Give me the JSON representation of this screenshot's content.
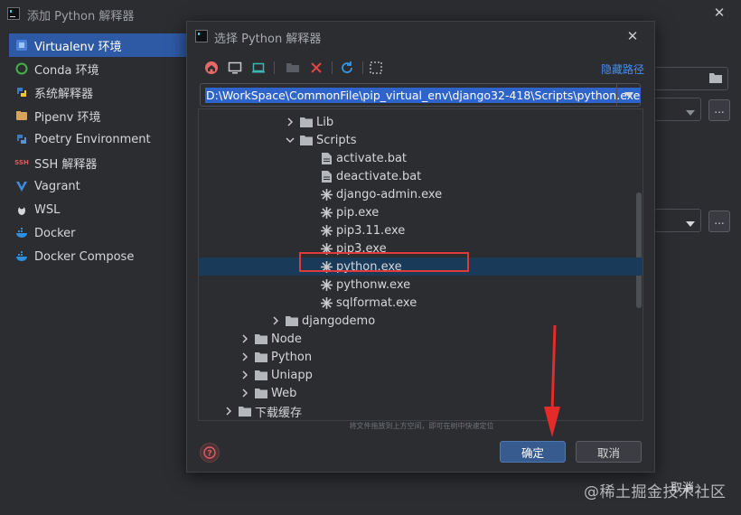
{
  "window": {
    "title": "添加 Python 解释器",
    "close": "✕"
  },
  "sidebar": {
    "items": [
      {
        "label": "Virtualenv 环境",
        "icon": "virtualenv-icon"
      },
      {
        "label": "Conda 环境",
        "icon": "conda-icon"
      },
      {
        "label": "系统解释器",
        "icon": "python-icon"
      },
      {
        "label": "Pipenv 环境",
        "icon": "pipenv-icon"
      },
      {
        "label": "Poetry Environment",
        "icon": "poetry-icon"
      },
      {
        "label": "SSH 解释器",
        "icon": "ssh-icon"
      },
      {
        "label": "Vagrant",
        "icon": "vagrant-icon"
      },
      {
        "label": "WSL",
        "icon": "linux-icon"
      },
      {
        "label": "Docker",
        "icon": "docker-icon"
      },
      {
        "label": "Docker Compose",
        "icon": "docker-compose-icon"
      }
    ]
  },
  "background": {
    "browse_btn": "...",
    "cancel_label": "取消"
  },
  "dialog": {
    "title": "选择 Python 解释器",
    "close": "✕",
    "hide_path": "隐藏路径",
    "path": "D:\\WorkSpace\\CommonFile\\pip_virtual_env\\django32-418\\Scripts\\python.exe",
    "hint": "将文件拖放到上方空间，即可在树中快速定位",
    "ok": "确定",
    "cancel": "取消",
    "help": "?"
  },
  "tree": [
    {
      "label": "Lib",
      "type": "folder",
      "expanded": false
    },
    {
      "label": "Scripts",
      "type": "folder",
      "expanded": true
    },
    {
      "label": "activate.bat",
      "type": "file"
    },
    {
      "label": "deactivate.bat",
      "type": "file"
    },
    {
      "label": "django-admin.exe",
      "type": "exe"
    },
    {
      "label": "pip.exe",
      "type": "exe"
    },
    {
      "label": "pip3.11.exe",
      "type": "exe"
    },
    {
      "label": "pip3.exe",
      "type": "exe"
    },
    {
      "label": "python.exe",
      "type": "exe",
      "selected": true
    },
    {
      "label": "pythonw.exe",
      "type": "exe"
    },
    {
      "label": "sqlformat.exe",
      "type": "exe"
    },
    {
      "label": "djangodemo",
      "type": "folder",
      "expanded": false
    },
    {
      "label": "Node",
      "type": "folder",
      "expanded": false
    },
    {
      "label": "Python",
      "type": "folder",
      "expanded": false
    },
    {
      "label": "Uniapp",
      "type": "folder",
      "expanded": false
    },
    {
      "label": "Web",
      "type": "folder",
      "expanded": false
    },
    {
      "label": "下载缓存",
      "type": "folder",
      "expanded": false
    }
  ],
  "watermark": "@稀土掘金技术社区",
  "colors": {
    "accent": "#2e5aa5",
    "selection_row": "#1a3a5a",
    "annotation_red": "#e03a3a",
    "link": "#4a8df0"
  }
}
